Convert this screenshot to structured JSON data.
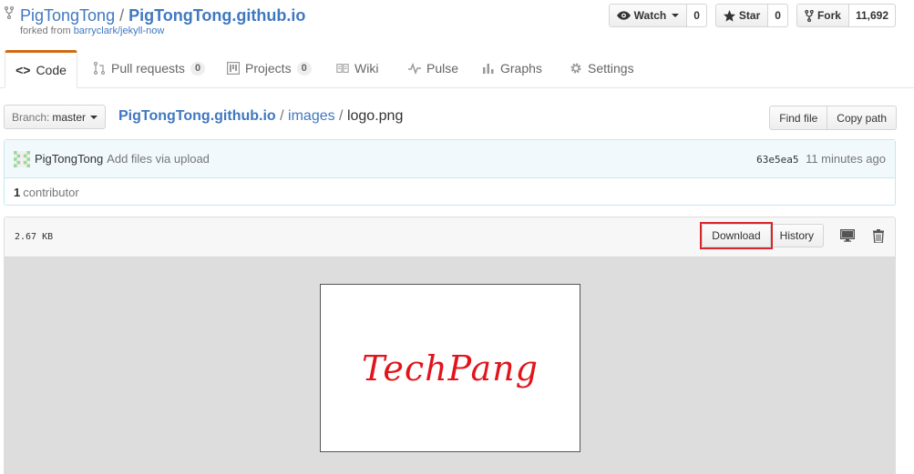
{
  "repo": {
    "owner": "PigTongTong",
    "separator": " / ",
    "name": "PigTongTong.github.io",
    "forked_from_prefix": "forked from ",
    "forked_from": "barryclark/jekyll-now"
  },
  "actions": {
    "watch_label": "Watch",
    "watch_count": "0",
    "star_label": "Star",
    "star_count": "0",
    "fork_label": "Fork",
    "fork_count": "11,692"
  },
  "nav": {
    "code": "Code",
    "pull_requests": "Pull requests",
    "pull_requests_count": "0",
    "projects": "Projects",
    "projects_count": "0",
    "wiki": "Wiki",
    "pulse": "Pulse",
    "graphs": "Graphs",
    "settings": "Settings"
  },
  "branch": {
    "label": "Branch:",
    "value": "master"
  },
  "breadcrumb": {
    "root": "PigTongTong.github.io",
    "sep": " / ",
    "dir": "images",
    "file": "logo.png"
  },
  "file_nav": {
    "find_file": "Find file",
    "copy_path": "Copy path"
  },
  "commit": {
    "author": "PigTongTong",
    "message": "Add files via upload",
    "sha": "63e5ea5",
    "time": "11 minutes ago",
    "contributors_count": "1",
    "contributors_label": "contributor"
  },
  "file": {
    "size": "2.67 KB",
    "download": "Download",
    "history": "History"
  },
  "image": {
    "text": "TechPang"
  },
  "colors": {
    "link": "#4078c0",
    "tab_accent": "#d26911",
    "highlight_box": "#d9252b",
    "logo_text": "#e1141c"
  },
  "icons": [
    "repo-forked-icon",
    "eye-icon",
    "star-icon",
    "fork-icon",
    "code-icon",
    "pull-request-icon",
    "project-icon",
    "wiki-icon",
    "pulse-icon",
    "graph-icon",
    "gear-icon",
    "desktop-icon",
    "trashcan-icon"
  ]
}
